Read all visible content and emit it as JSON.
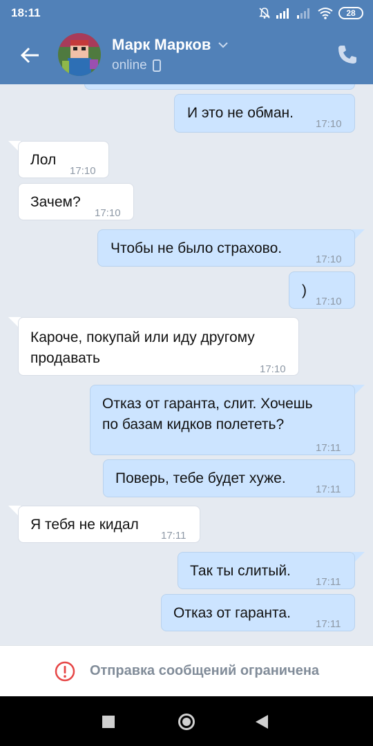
{
  "status_bar": {
    "time": "18:11",
    "battery": "28",
    "icons": [
      "bell-off-icon",
      "signal-icon",
      "signal-weak-icon",
      "wifi-icon",
      "battery-icon"
    ]
  },
  "header": {
    "name": "Марк Марков",
    "status": "online",
    "colors": {
      "bar": "#5181b8",
      "status_text": "#c9d9ee"
    }
  },
  "messages": [
    {
      "dir": "out",
      "text": "И это не обман.",
      "time": "17:10"
    },
    {
      "dir": "in",
      "text": "Лол",
      "time": "17:10"
    },
    {
      "dir": "in",
      "text": "Зачем?",
      "time": "17:10"
    },
    {
      "dir": "out",
      "text": "Чтобы не было страхово.",
      "time": "17:10"
    },
    {
      "dir": "out",
      "text": ")",
      "time": "17:10"
    },
    {
      "dir": "in",
      "lines": [
        "Кароче, покупай или иду другому",
        "продавать"
      ],
      "time": "17:10"
    },
    {
      "dir": "out",
      "lines": [
        "Отказ от гаранта, слит. Хочешь",
        "по базам кидков полететь?"
      ],
      "time": "17:11"
    },
    {
      "dir": "out",
      "text": "Поверь, тебе будет хуже.",
      "time": "17:11"
    },
    {
      "dir": "in",
      "text": "Я тебя не кидал",
      "time": "17:11"
    },
    {
      "dir": "out",
      "text": "Так ты слитый.",
      "time": "17:11"
    },
    {
      "dir": "out",
      "text": "Отказ от гаранта.",
      "time": "17:11"
    }
  ],
  "bottom": {
    "restriction_text": "Отправка сообщений ограничена",
    "colors": {
      "warning": "#e64646"
    }
  },
  "colors": {
    "incoming_bg": "#ffffff",
    "outgoing_bg": "#cce4ff",
    "chat_bg": "#e5eaf1"
  }
}
